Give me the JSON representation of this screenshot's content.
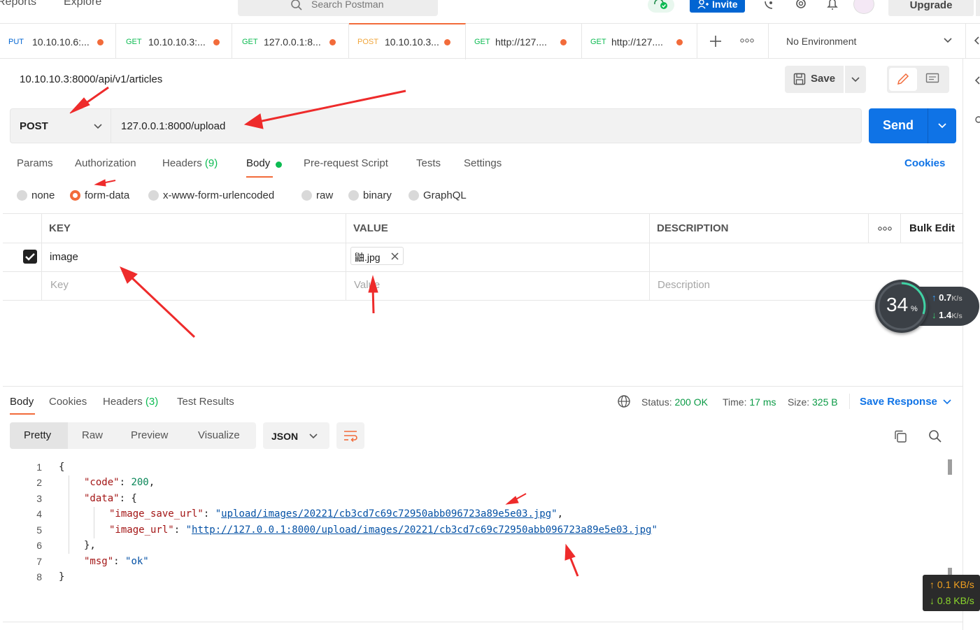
{
  "topbar": {
    "nav": [
      "Reports",
      "Explore"
    ],
    "search_placeholder": "Search Postman",
    "invite_label": "Invite",
    "upgrade_label": "Upgrade"
  },
  "tabs": [
    {
      "method": "PUT",
      "url": "10.10.10.6:..."
    },
    {
      "method": "GET",
      "url": "10.10.10.3:..."
    },
    {
      "method": "GET",
      "url": "127.0.0.1:8..."
    },
    {
      "method": "POST",
      "url": "10.10.10.3..."
    },
    {
      "method": "GET",
      "url": "http://127...."
    },
    {
      "method": "GET",
      "url": "http://127...."
    }
  ],
  "environment": "No Environment",
  "request": {
    "name": "10.10.10.3:8000/api/v1/articles",
    "save_label": "Save",
    "method": "POST",
    "url": "127.0.0.1:8000/upload",
    "send_label": "Send"
  },
  "request_tabs": {
    "params": "Params",
    "authorization": "Authorization",
    "headers": "Headers",
    "headers_count": "(9)",
    "body": "Body",
    "prerequest": "Pre-request Script",
    "tests": "Tests",
    "settings": "Settings",
    "cookies": "Cookies"
  },
  "body_modes": [
    "none",
    "form-data",
    "x-www-form-urlencoded",
    "raw",
    "binary",
    "GraphQL"
  ],
  "kv_table": {
    "headers": {
      "key": "KEY",
      "value": "VALUE",
      "description": "DESCRIPTION",
      "bulk": "Bulk Edit"
    },
    "row": {
      "key": "image",
      "value_file": "鼬.jpg"
    },
    "placeholders": {
      "key": "Key",
      "value": "Value",
      "description": "Description"
    }
  },
  "response": {
    "tabs": {
      "body": "Body",
      "cookies": "Cookies",
      "headers": "Headers",
      "headers_count": "(3)",
      "tests": "Test Results"
    },
    "status_label": "Status:",
    "status_value": "200 OK",
    "time_label": "Time:",
    "time_value": "17 ms",
    "size_label": "Size:",
    "size_value": "325 B",
    "save_response": "Save Response",
    "formats": [
      "Pretty",
      "Raw",
      "Preview",
      "Visualize"
    ],
    "language": "JSON",
    "json": {
      "code_key": "\"code\"",
      "code_val": "200",
      "data_key": "\"data\"",
      "save_url_key": "\"image_save_url\"",
      "save_url_val": "upload/images/20221/cb3cd7c69c72950abb096723a89e5e03.jpg",
      "image_url_key": "\"image_url\"",
      "image_url_val": "http://127.0.0.1:8000/upload/images/20221/cb3cd7c69c72950abb096723a89e5e03.jpg",
      "msg_key": "\"msg\"",
      "msg_val": "\"ok\""
    },
    "line_numbers": [
      "1",
      "2",
      "3",
      "4",
      "5",
      "6",
      "7",
      "8"
    ]
  },
  "overlay": {
    "gauge_percent": "34",
    "gauge_unit": "%",
    "up_speed": "0.7",
    "down_speed": "1.4",
    "speed_unit": "K/s",
    "net_up": "0.1 KB/s",
    "net_down": "0.8 KB/s"
  },
  "colors": {
    "accent": "#f26b3a",
    "brand_blue": "#0f73e6",
    "success": "#0cbb52"
  }
}
